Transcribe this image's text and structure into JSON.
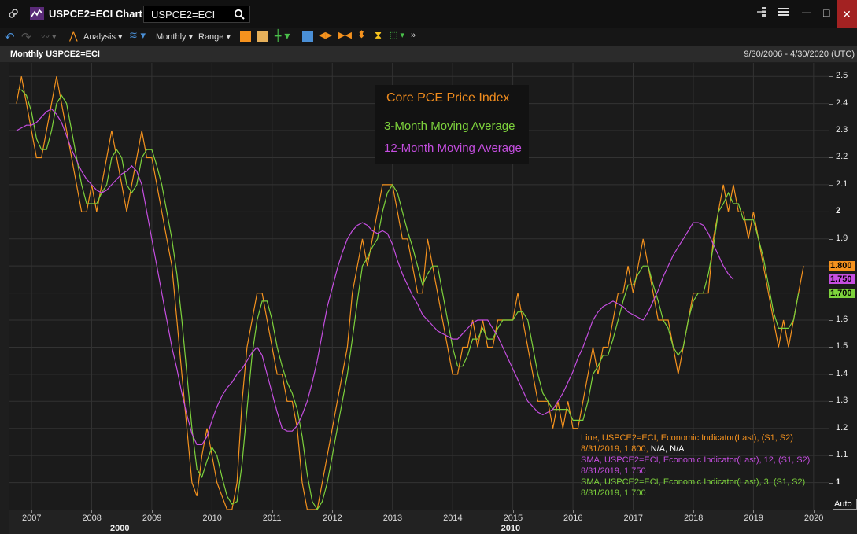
{
  "window": {
    "title": "USPCE2=ECI Chart",
    "search_value": "USPCE2=ECI",
    "minimize": "—",
    "maximize": "□",
    "close": "✕"
  },
  "toolbar": {
    "analysis": "Analysis",
    "interval": "Monthly",
    "range": "Range"
  },
  "chart_header": {
    "title": "Monthly USPCE2=ECI",
    "date_range": "9/30/2006 - 4/30/2020 (UTC)"
  },
  "legend": {
    "title": "Core PCE Price Index",
    "ma3": "3-Month Moving Average",
    "ma12": "12-Month Moving Average"
  },
  "info_lines": {
    "line1": "Line, USPCE2=ECI, Economic Indicator(Last), (S1, S2)",
    "line1_val": "8/31/2019, 1.800,",
    "line1_na": "N/A, N/A",
    "line2": "SMA, USPCE2=ECI, Economic Indicator(Last),  12, (S1, S2)",
    "line2_val": "8/31/2019, 1.750",
    "line3": "SMA, USPCE2=ECI, Economic Indicator(Last),  3, (S1, S2)",
    "line3_val": "8/31/2019, 1.700"
  },
  "last_values": {
    "line": "1.800",
    "sma12": "1.750",
    "sma3": "1.700"
  },
  "auto_label": "Auto",
  "colors": {
    "line": "#f5921e",
    "sma3": "#7dd23c",
    "sma12": "#c54ee0"
  },
  "chart_data": {
    "type": "line",
    "ylim": [
      0.9,
      2.55
    ],
    "yticks": [
      "1",
      "1.1",
      "1.2",
      "1.3",
      "1.4",
      "1.5",
      "1.6",
      "1.7",
      "1.8",
      "1.9",
      "2",
      "2.1",
      "2.2",
      "2.3",
      "2.4",
      "2.5"
    ],
    "x_labels": [
      "2007",
      "2008",
      "2009",
      "2010",
      "2011",
      "2012",
      "2013",
      "2014",
      "2015",
      "2016",
      "2017",
      "2018",
      "2019",
      "2020"
    ],
    "x_decades": [
      "2000",
      "2010"
    ],
    "x_start": 2006.75,
    "grid": true,
    "series": [
      {
        "key": "line",
        "values": [
          2.4,
          2.5,
          2.4,
          2.3,
          2.2,
          2.2,
          2.3,
          2.4,
          2.5,
          2.4,
          2.3,
          2.2,
          2.1,
          2.0,
          2.0,
          2.1,
          2.0,
          2.1,
          2.2,
          2.3,
          2.2,
          2.1,
          2.0,
          2.1,
          2.2,
          2.3,
          2.2,
          2.2,
          2.1,
          2.0,
          1.9,
          1.8,
          1.6,
          1.4,
          1.2,
          1.0,
          0.95,
          1.1,
          1.2,
          1.1,
          1.0,
          0.95,
          0.9,
          0.9,
          1.0,
          1.3,
          1.5,
          1.6,
          1.7,
          1.7,
          1.6,
          1.5,
          1.4,
          1.4,
          1.3,
          1.3,
          1.2,
          1.0,
          0.9,
          0.9,
          0.9,
          1.0,
          1.1,
          1.2,
          1.3,
          1.4,
          1.5,
          1.7,
          1.8,
          1.9,
          1.8,
          1.9,
          2.0,
          2.1,
          2.1,
          2.1,
          2.0,
          1.9,
          1.9,
          1.8,
          1.7,
          1.7,
          1.9,
          1.8,
          1.7,
          1.6,
          1.5,
          1.4,
          1.4,
          1.5,
          1.5,
          1.6,
          1.5,
          1.6,
          1.5,
          1.5,
          1.6,
          1.6,
          1.6,
          1.6,
          1.7,
          1.6,
          1.5,
          1.4,
          1.3,
          1.3,
          1.3,
          1.2,
          1.3,
          1.2,
          1.3,
          1.2,
          1.2,
          1.3,
          1.4,
          1.5,
          1.4,
          1.5,
          1.5,
          1.6,
          1.7,
          1.7,
          1.8,
          1.7,
          1.8,
          1.9,
          1.8,
          1.7,
          1.6,
          1.6,
          1.6,
          1.5,
          1.4,
          1.5,
          1.6,
          1.7,
          1.7,
          1.7,
          1.7,
          1.9,
          2.0,
          2.1,
          2.0,
          2.1,
          2.0,
          2.0,
          1.9,
          2.0,
          1.9,
          1.8,
          1.7,
          1.6,
          1.5,
          1.6,
          1.5,
          1.6,
          1.7,
          1.8
        ]
      },
      {
        "key": "sma3",
        "values": [
          2.45,
          2.45,
          2.43,
          2.37,
          2.27,
          2.23,
          2.23,
          2.3,
          2.4,
          2.43,
          2.4,
          2.3,
          2.2,
          2.1,
          2.03,
          2.03,
          2.03,
          2.07,
          2.1,
          2.2,
          2.23,
          2.2,
          2.1,
          2.07,
          2.1,
          2.2,
          2.23,
          2.23,
          2.17,
          2.1,
          2.0,
          1.9,
          1.77,
          1.6,
          1.4,
          1.2,
          1.05,
          1.02,
          1.08,
          1.13,
          1.1,
          1.02,
          0.95,
          0.92,
          0.93,
          1.07,
          1.27,
          1.47,
          1.6,
          1.67,
          1.67,
          1.6,
          1.5,
          1.43,
          1.37,
          1.33,
          1.27,
          1.17,
          1.03,
          0.93,
          0.9,
          0.93,
          1.0,
          1.1,
          1.2,
          1.3,
          1.4,
          1.53,
          1.67,
          1.8,
          1.83,
          1.87,
          1.9,
          2.0,
          2.07,
          2.1,
          2.07,
          2.0,
          1.93,
          1.87,
          1.8,
          1.73,
          1.77,
          1.8,
          1.8,
          1.7,
          1.6,
          1.5,
          1.43,
          1.43,
          1.47,
          1.53,
          1.53,
          1.57,
          1.53,
          1.53,
          1.57,
          1.6,
          1.6,
          1.6,
          1.63,
          1.63,
          1.6,
          1.5,
          1.4,
          1.33,
          1.3,
          1.27,
          1.27,
          1.27,
          1.27,
          1.23,
          1.23,
          1.23,
          1.3,
          1.4,
          1.43,
          1.47,
          1.47,
          1.53,
          1.6,
          1.67,
          1.73,
          1.73,
          1.77,
          1.8,
          1.8,
          1.73,
          1.67,
          1.6,
          1.57,
          1.5,
          1.47,
          1.5,
          1.6,
          1.67,
          1.7,
          1.7,
          1.77,
          1.87,
          2.0,
          2.03,
          2.07,
          2.03,
          2.03,
          1.97,
          1.97,
          1.97,
          1.9,
          1.83,
          1.73,
          1.63,
          1.57,
          1.57,
          1.57,
          1.6,
          1.7
        ]
      },
      {
        "key": "sma12",
        "values": [
          2.3,
          2.31,
          2.32,
          2.32,
          2.33,
          2.35,
          2.37,
          2.38,
          2.36,
          2.33,
          2.28,
          2.23,
          2.19,
          2.15,
          2.12,
          2.1,
          2.08,
          2.07,
          2.08,
          2.1,
          2.12,
          2.14,
          2.15,
          2.17,
          2.15,
          2.1,
          2.0,
          1.9,
          1.8,
          1.7,
          1.6,
          1.5,
          1.42,
          1.33,
          1.25,
          1.18,
          1.14,
          1.14,
          1.17,
          1.23,
          1.28,
          1.32,
          1.35,
          1.37,
          1.4,
          1.42,
          1.45,
          1.48,
          1.5,
          1.47,
          1.4,
          1.33,
          1.26,
          1.2,
          1.19,
          1.19,
          1.21,
          1.25,
          1.3,
          1.37,
          1.45,
          1.55,
          1.65,
          1.72,
          1.79,
          1.85,
          1.9,
          1.93,
          1.95,
          1.96,
          1.95,
          1.93,
          1.92,
          1.93,
          1.92,
          1.88,
          1.82,
          1.77,
          1.73,
          1.69,
          1.66,
          1.62,
          1.6,
          1.58,
          1.56,
          1.55,
          1.54,
          1.53,
          1.53,
          1.55,
          1.57,
          1.59,
          1.6,
          1.6,
          1.6,
          1.57,
          1.54,
          1.5,
          1.46,
          1.42,
          1.38,
          1.34,
          1.3,
          1.28,
          1.26,
          1.25,
          1.26,
          1.27,
          1.3,
          1.33,
          1.37,
          1.41,
          1.46,
          1.5,
          1.55,
          1.6,
          1.63,
          1.65,
          1.66,
          1.67,
          1.66,
          1.65,
          1.63,
          1.62,
          1.61,
          1.6,
          1.63,
          1.67,
          1.71,
          1.76,
          1.8,
          1.84,
          1.87,
          1.9,
          1.93,
          1.96,
          1.96,
          1.95,
          1.92,
          1.88,
          1.84,
          1.8,
          1.77,
          1.75
        ]
      }
    ]
  }
}
